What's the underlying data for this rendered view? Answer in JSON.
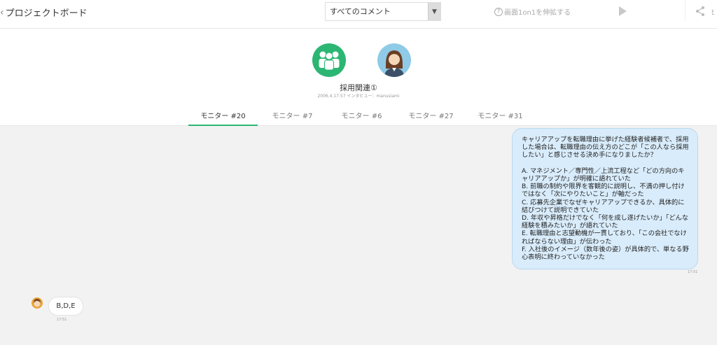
{
  "header": {
    "back_label": "プロジェクトボード",
    "comment_filter": "すべてのコメント",
    "help_label": "画面1on1を伸拡する",
    "edge_text": "ﾋ"
  },
  "project": {
    "title": "採用関連①",
    "meta": "2006.4.17.57 インタビュー：manusiami"
  },
  "tabs": [
    {
      "label": "モニター #20"
    },
    {
      "label": "モニター #7"
    },
    {
      "label": "モニター #6"
    },
    {
      "label": "モニター #27"
    },
    {
      "label": "モニター #31"
    }
  ],
  "messages": {
    "question": "キャリアアップを転職理由に挙げた経験者候補者で、採用した場合は、転職理由の伝え方のどこが「この人なら採用したい」と感じさせる決め手になりましたか？\n\nA. マネジメント／専門性／上流工程など「どの方向のキャリアアップか」が明確に語れていた\nB. 前職の制約や限界を客観的に説明し、不満の押し付けではなく「次にやりたいこと」が軸だった\nC. 応募先企業でなぜキャリアアップできるか、具体的に結びつけて説明できていた\nD. 年収や昇格だけでなく「何を成し遂げたいか」「どんな経験を積みたいか」が語れていた\nE. 転職理由と志望動機が一貫しており、「この会社でなければならない理由」が伝わった\nF. 入社後のイメージ（数年後の姿）が具体的で、単なる野心表明に終わっていなかった",
    "question_time": "17:51",
    "answer": "B,D,E",
    "answer_time": "17:51"
  },
  "colors": {
    "accent": "#2bb673",
    "bubble_blue": "#d9ecfb"
  }
}
